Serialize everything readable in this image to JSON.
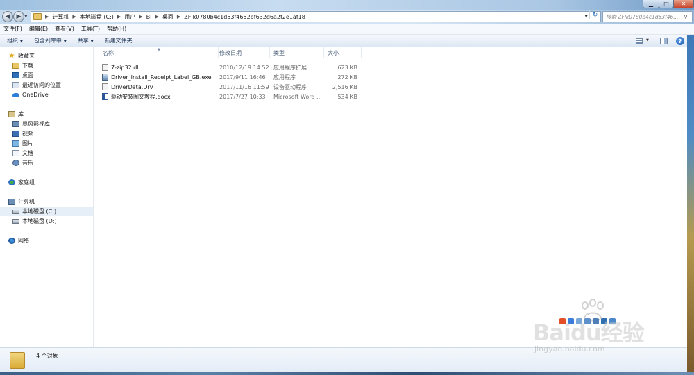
{
  "window": {
    "minimize_glyph": "▁",
    "maximize_glyph": "□",
    "close_glyph": "✕"
  },
  "address": {
    "crumbs": [
      "计算机",
      "本地磁盘 (C:)",
      "用户",
      "BI",
      "桌面",
      "ZFlk0780b4c1d53f4652bf632d6a2f2e1af18"
    ],
    "search_placeholder": "搜索 ZFlk0780b4c1d53f46..."
  },
  "menubar": [
    "文件(F)",
    "编辑(E)",
    "查看(V)",
    "工具(T)",
    "帮助(H)"
  ],
  "commands": {
    "organize": "组织",
    "include_library": "包含到库中",
    "share": "共享",
    "new_folder": "新建文件夹"
  },
  "navpane": {
    "favorites": "收藏夹",
    "downloads": "下载",
    "desktop": "桌面",
    "recent": "最近访问的位置",
    "onedrive": "OneDrive",
    "libraries": "库",
    "storm": "暴风影视库",
    "videos": "视频",
    "pictures": "图片",
    "documents": "文档",
    "music": "音乐",
    "homegroup": "家庭组",
    "computer": "计算机",
    "drive_c": "本地磁盘 (C:)",
    "drive_d": "本地磁盘 (D:)",
    "network": "网络"
  },
  "columns": {
    "name": "名称",
    "date": "修改日期",
    "type": "类型",
    "size": "大小"
  },
  "files": [
    {
      "name": "7-zip32.dll",
      "date": "2010/12/19 14:52",
      "type": "应用程序扩展",
      "size": "623 KB",
      "icon": "dll-icon"
    },
    {
      "name": "Driver_Install_Receipt_Label_GB.exe",
      "date": "2017/9/11 16:46",
      "type": "应用程序",
      "size": "272 KB",
      "icon": "exe-icon"
    },
    {
      "name": "DriverData.Drv",
      "date": "2017/11/16 11:59",
      "type": "设备驱动程序",
      "size": "2,516 KB",
      "icon": "drv-icon"
    },
    {
      "name": "驱动安装图文教程.docx",
      "date": "2017/7/27 10:33",
      "type": "Microsoft Word ...",
      "size": "534 KB",
      "icon": "word-doc-icon"
    }
  ],
  "details": {
    "count": "4 个对象"
  },
  "watermark": {
    "brand": "Baidu经验",
    "url": "jingyan.baidu.com"
  },
  "colors": {
    "accent": "#2b579a",
    "selection": "#e6eef7",
    "close_button": "#c6452b"
  }
}
